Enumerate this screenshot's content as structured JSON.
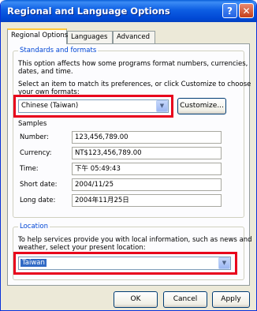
{
  "window": {
    "title": "Regional and Language Options",
    "help_glyph": "?",
    "close_glyph": "✕"
  },
  "tabs": [
    {
      "label": "Regional Options",
      "active": true
    },
    {
      "label": "Languages",
      "active": false
    },
    {
      "label": "Advanced",
      "active": false
    }
  ],
  "standards": {
    "legend": "Standards and formats",
    "desc_line1": "This option affects how some programs format numbers, currencies,",
    "desc_line2": "dates, and time.",
    "prompt_line1": "Select an item to match its preferences, or click Customize to choose",
    "prompt_line2": "your own formats:",
    "selected_format": "Chinese (Taiwan)",
    "customize_label": "Customize...",
    "samples_title": "Samples",
    "samples": [
      {
        "label": "Number:",
        "value": "123,456,789.00"
      },
      {
        "label": "Currency:",
        "value": "NT$123,456,789.00"
      },
      {
        "label": "Time:",
        "value": "下午 05:49:43"
      },
      {
        "label": "Short date:",
        "value": "2004/11/25"
      },
      {
        "label": "Long date:",
        "value": "2004年11月25日"
      }
    ]
  },
  "location": {
    "legend": "Location",
    "desc_line1": "To help services provide you with local information, such as news and",
    "desc_line2": "weather, select your present location:",
    "selected": "Taiwan"
  },
  "buttons": {
    "ok": "OK",
    "cancel": "Cancel",
    "apply": "Apply"
  },
  "colors": {
    "highlight": "#e8001c",
    "titlebar": "#0054e3",
    "legend": "#0046d5"
  }
}
